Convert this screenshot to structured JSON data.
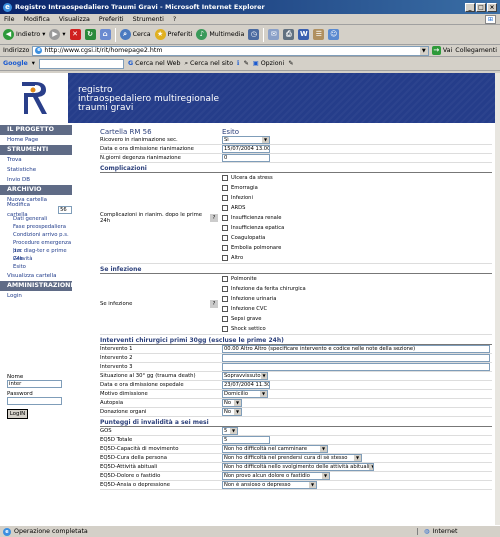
{
  "window": {
    "title": "Registro Intraospedaliero Traumi Gravi - Microsoft Internet Explorer"
  },
  "menu": [
    "File",
    "Modifica",
    "Visualizza",
    "Preferiti",
    "Strumenti",
    "?"
  ],
  "toolbar": {
    "back": "Indietro",
    "search": "Cerca",
    "favorites": "Preferiti",
    "media": "Multimedia"
  },
  "address": {
    "label": "Indirizzo",
    "url": "http://www.cgsi.it/rit/homepage2.htm",
    "go": "Vai",
    "links": "Collegamenti"
  },
  "google_bar": {
    "logo": "Google",
    "web": "Cerca nel Web",
    "site": "Cerca nel sito",
    "options": "Opzioni"
  },
  "banner": {
    "line1": "registro",
    "line2": "intraospedaliero multiregionale",
    "line3": "traumi gravi"
  },
  "sidebar": {
    "progetto": {
      "head": "IL PROGETTO",
      "items": [
        "Home Page"
      ]
    },
    "strumenti": {
      "head": "STRUMENTI",
      "items": [
        "Trova",
        "Statistiche",
        "Invio DB"
      ]
    },
    "archivio": {
      "head": "ARCHIVIO",
      "items": [
        "Nuova cartella",
        "Modifica cartella"
      ],
      "modifica_value": "56",
      "sub": [
        "Dati generali",
        "Fase preospedaliera",
        "Condizioni arrivo p.s.",
        "Procedure emergenza p.s.",
        "Iter diag-ter e prime 24h",
        "Gravità",
        "Esito"
      ],
      "after": [
        "Visualizza cartella"
      ]
    },
    "amministrazione": {
      "head": "AMMINISTRAZIONE",
      "items": [
        "Login"
      ]
    },
    "login": {
      "name_label": "Nome",
      "name_value": "inter",
      "password_label": "Password",
      "button": "LogIN"
    }
  },
  "main": {
    "cartella": "Cartella RM 56",
    "esito": "Esito",
    "rows1": [
      {
        "label": "Ricovero in rianimazione sec.",
        "value": "Sì",
        "type": "select"
      },
      {
        "label": "Data e ora dimissione rianimazione",
        "value": "15/07/2004 13.00",
        "type": "text"
      },
      {
        "label": "N.giorni degenza rianimazione",
        "value": "0",
        "type": "text"
      }
    ],
    "complicazioni": {
      "title": "Complicazioni",
      "label": "Complicazioni in rianim. dopo le prime 24h",
      "qm": "?",
      "options": [
        "Ulcera da stress",
        "Emorragia",
        "Infezioni",
        "ARDS",
        "Insufficienza renale",
        "Insufficienza epatica",
        "Coagulopatia",
        "Embolia polmonare",
        "Altro"
      ]
    },
    "infezione": {
      "title": "Se infezione",
      "label": "Se infezione",
      "qm": "?",
      "options": [
        "Polmonite",
        "Infezione da ferita chirurgica",
        "Infezione urinaria",
        "Infezione CVC",
        "Sepsi grave",
        "Shock settico"
      ]
    },
    "interventi": {
      "title": "Interventi chirurgici primi 30gg (escluse le prime 24h)",
      "rows": [
        {
          "label": "Intervento 1",
          "value": "00.00 Altro Altro (specificare intervento e codice nelle note della sezione)",
          "type": "text"
        },
        {
          "label": "Intervento 2",
          "value": "",
          "type": "text"
        },
        {
          "label": "Intervento 3",
          "value": "",
          "type": "text"
        },
        {
          "label": "Situazione al 30° gg (trauma death)",
          "value": "Sopravvissuto",
          "type": "select"
        },
        {
          "label": "Data e ora dimissione ospedale",
          "value": "23/07/2004 11.30",
          "type": "text"
        },
        {
          "label": "Motivo dimissione",
          "value": "Domicilio",
          "type": "select"
        },
        {
          "label": "Autopsia",
          "value": "No",
          "type": "select"
        },
        {
          "label": "Donazione organi",
          "value": "No",
          "type": "select"
        }
      ]
    },
    "punteggi": {
      "title": "Punteggi di invalidità a sei mesi",
      "rows": [
        {
          "label": "GOS",
          "value": "5",
          "type": "select"
        },
        {
          "label": "EQ5D Totale",
          "value": "5",
          "type": "text"
        },
        {
          "label": "EQ5D-Capacità di movimento",
          "value": "Non ho difficoltà nel camminare",
          "type": "select"
        },
        {
          "label": "EQ5D-Cura della persona",
          "value": "Non ho difficoltà nel prendersi cura di sé stesso",
          "type": "select"
        },
        {
          "label": "EQ5D-Attività abituali",
          "value": "Non ho difficoltà nello svolgimento delle attività abituali",
          "type": "select"
        },
        {
          "label": "EQ5D-Dolore o fastidio",
          "value": "Non provo alcun dolore o fastidio",
          "type": "select"
        },
        {
          "label": "EQ5D-Ansia o depressione",
          "value": "Non è ansioso o depresso",
          "type": "select"
        }
      ]
    }
  },
  "status": {
    "left": "Operazione completata",
    "zone": "Internet"
  }
}
